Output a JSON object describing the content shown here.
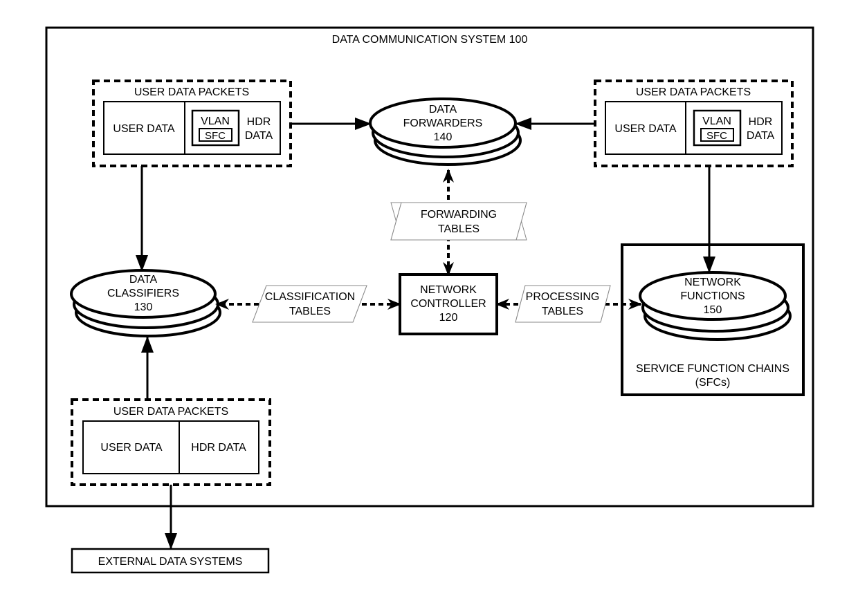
{
  "system": {
    "title": "DATA COMMUNICATION SYSTEM 100"
  },
  "packets": {
    "top_left": {
      "title": "USER DATA PACKETS",
      "user_data": "USER DATA",
      "vlan": "VLAN",
      "sfc": "SFC",
      "hdr_line1": "HDR",
      "hdr_line2": "DATA"
    },
    "top_right": {
      "title": "USER DATA PACKETS",
      "user_data": "USER DATA",
      "vlan": "VLAN",
      "sfc": "SFC",
      "hdr_line1": "HDR",
      "hdr_line2": "DATA"
    },
    "bottom": {
      "title": "USER DATA PACKETS",
      "user_data": "USER DATA",
      "hdr_data": "HDR DATA"
    }
  },
  "forwarders": {
    "line1": "DATA",
    "line2": "FORWARDERS",
    "line3": "140"
  },
  "classifiers": {
    "line1": "DATA",
    "line2": "CLASSIFIERS",
    "line3": "130"
  },
  "controller": {
    "line1": "NETWORK",
    "line2": "CONTROLLER",
    "line3": "120"
  },
  "functions": {
    "line1": "NETWORK",
    "line2": "FUNCTIONS",
    "line3": "150"
  },
  "sfc_box": {
    "line1": "SERVICE FUNCTION CHAINS",
    "line2": "(SFCs)"
  },
  "tables": {
    "forwarding": {
      "line1": "FORWARDING",
      "line2": "TABLES"
    },
    "classification": {
      "line1": "CLASSIFICATION",
      "line2": "TABLES"
    },
    "processing": {
      "line1": "PROCESSING",
      "line2": "TABLES"
    }
  },
  "external": {
    "label": "EXTERNAL DATA SYSTEMS"
  }
}
